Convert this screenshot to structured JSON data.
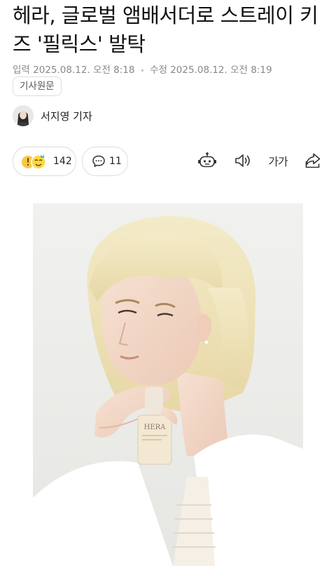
{
  "article": {
    "title": "헤라, 글로벌 앰배서더로 스트레이 키즈 '필릭스' 발탁",
    "published_label": "입력",
    "published_time": "2025.08.12. 오전 8:18",
    "modified_label": "수정",
    "modified_time": "2025.08.12. 오전 8:19",
    "origin_button": "기사원문",
    "reporter": "서지영 기자"
  },
  "actions": {
    "reaction_count": "142",
    "comment_count": "11",
    "font_size_label": "가가",
    "icons": [
      "reaction-emoji-icon",
      "comment-icon",
      "robot-summary-icon",
      "speaker-icon",
      "font-size-icon",
      "share-icon"
    ]
  },
  "photo": {
    "brand_text": "HERA",
    "description_icon": "model-with-foundation-bottle"
  },
  "colors": {
    "text": "#111111",
    "meta": "#888888",
    "border": "#dddddd",
    "photo_bg": "#ececea",
    "hair": "#efe3b8",
    "jacket": "#ffffff"
  }
}
